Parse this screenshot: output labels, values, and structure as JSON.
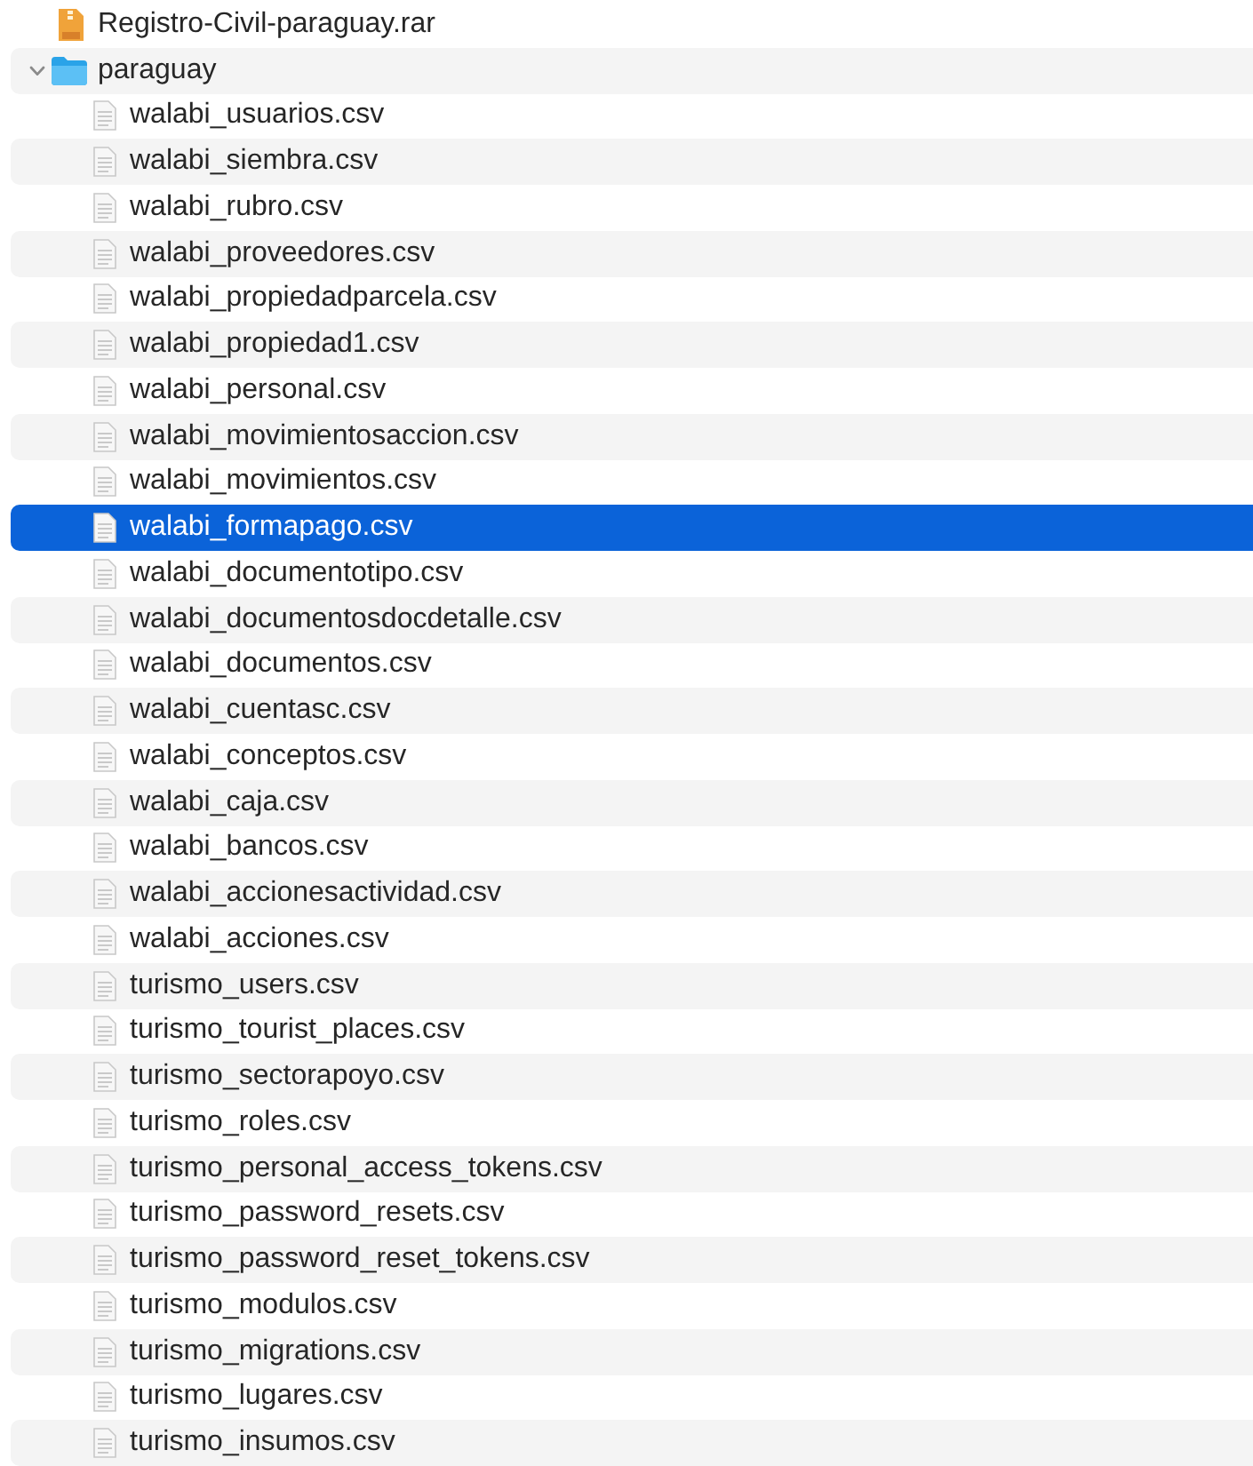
{
  "items": [
    {
      "kind": "archive",
      "name": "Registro-Civil-paraguay.rar",
      "selected": false
    },
    {
      "kind": "folder",
      "name": "paraguay",
      "expanded": true,
      "selected": false,
      "children": [
        {
          "kind": "file",
          "name": "walabi_usuarios.csv",
          "selected": false
        },
        {
          "kind": "file",
          "name": "walabi_siembra.csv",
          "selected": false
        },
        {
          "kind": "file",
          "name": "walabi_rubro.csv",
          "selected": false
        },
        {
          "kind": "file",
          "name": "walabi_proveedores.csv",
          "selected": false
        },
        {
          "kind": "file",
          "name": "walabi_propiedadparcela.csv",
          "selected": false
        },
        {
          "kind": "file",
          "name": "walabi_propiedad1.csv",
          "selected": false
        },
        {
          "kind": "file",
          "name": "walabi_personal.csv",
          "selected": false
        },
        {
          "kind": "file",
          "name": "walabi_movimientosaccion.csv",
          "selected": false
        },
        {
          "kind": "file",
          "name": "walabi_movimientos.csv",
          "selected": false
        },
        {
          "kind": "file",
          "name": "walabi_formapago.csv",
          "selected": true
        },
        {
          "kind": "file",
          "name": "walabi_documentotipo.csv",
          "selected": false
        },
        {
          "kind": "file",
          "name": "walabi_documentosdocdetalle.csv",
          "selected": false
        },
        {
          "kind": "file",
          "name": "walabi_documentos.csv",
          "selected": false
        },
        {
          "kind": "file",
          "name": "walabi_cuentasc.csv",
          "selected": false
        },
        {
          "kind": "file",
          "name": "walabi_conceptos.csv",
          "selected": false
        },
        {
          "kind": "file",
          "name": "walabi_caja.csv",
          "selected": false
        },
        {
          "kind": "file",
          "name": "walabi_bancos.csv",
          "selected": false
        },
        {
          "kind": "file",
          "name": "walabi_accionesactividad.csv",
          "selected": false
        },
        {
          "kind": "file",
          "name": "walabi_acciones.csv",
          "selected": false
        },
        {
          "kind": "file",
          "name": "turismo_users.csv",
          "selected": false
        },
        {
          "kind": "file",
          "name": "turismo_tourist_places.csv",
          "selected": false
        },
        {
          "kind": "file",
          "name": "turismo_sectorapoyo.csv",
          "selected": false
        },
        {
          "kind": "file",
          "name": "turismo_roles.csv",
          "selected": false
        },
        {
          "kind": "file",
          "name": "turismo_personal_access_tokens.csv",
          "selected": false
        },
        {
          "kind": "file",
          "name": "turismo_password_resets.csv",
          "selected": false
        },
        {
          "kind": "file",
          "name": "turismo_password_reset_tokens.csv",
          "selected": false
        },
        {
          "kind": "file",
          "name": "turismo_modulos.csv",
          "selected": false
        },
        {
          "kind": "file",
          "name": "turismo_migrations.csv",
          "selected": false
        },
        {
          "kind": "file",
          "name": "turismo_lugares.csv",
          "selected": false
        },
        {
          "kind": "file",
          "name": "turismo_insumos.csv",
          "selected": false
        }
      ]
    }
  ]
}
